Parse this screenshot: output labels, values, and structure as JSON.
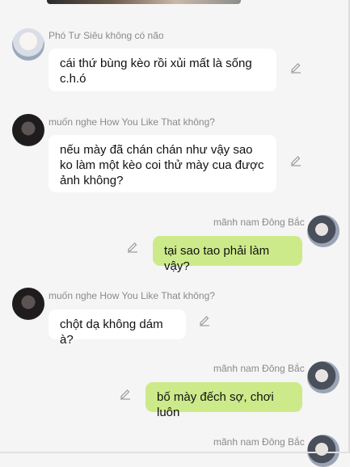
{
  "messages": [
    {
      "sender": "Phó Tư Siêu không có não",
      "text": "cái thứ bùng kèo rồi xủi mất là sống c.h.ó",
      "side": "incoming"
    },
    {
      "sender": "muốn nghe How You Like That không?",
      "text": "nếu mày đã chán chán như vậy sao ko làm một kèo coi thử mày cua được ảnh không?",
      "side": "incoming"
    },
    {
      "sender": "mãnh nam Đông Bắc",
      "text": "tại sao tao phải làm vậy?",
      "side": "outgoing"
    },
    {
      "sender": "muốn nghe How You Like That không?",
      "text": "chột dạ không dám à?",
      "side": "incoming"
    },
    {
      "sender": "mãnh nam Đông Bắc",
      "text": "bố mày đếch sợ, chơi luôn",
      "side": "outgoing"
    },
    {
      "sender": "mãnh nam Đông Bắc",
      "text": "",
      "side": "outgoing"
    }
  ],
  "icons": {
    "edit": "pencil-icon",
    "avatar": "avatar"
  },
  "colors": {
    "incoming_bubble": "#ffffff",
    "outgoing_bubble": "#cdea8a",
    "background": "#f5f5f5",
    "name_text": "#8a8a8a"
  }
}
